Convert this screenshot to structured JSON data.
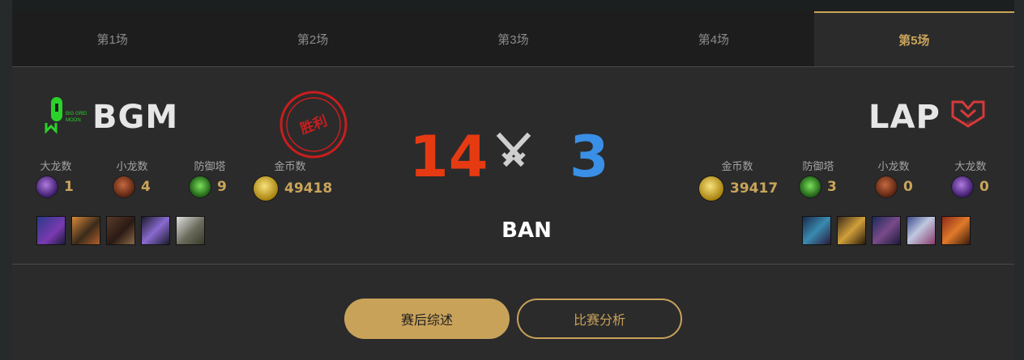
{
  "tabs": [
    {
      "label": "第1场"
    },
    {
      "label": "第2场"
    },
    {
      "label": "第3场"
    },
    {
      "label": "第4场"
    },
    {
      "label": "第5场",
      "active": true
    }
  ],
  "left_team": {
    "name": "BGM",
    "logo_icon": "bgm-logo-icon",
    "win_stamp": "胜利",
    "stats": [
      {
        "label": "大龙数",
        "value": "1",
        "icon": "baron-icon"
      },
      {
        "label": "小龙数",
        "value": "4",
        "icon": "dragon-icon"
      },
      {
        "label": "防御塔",
        "value": "9",
        "icon": "tower-icon"
      },
      {
        "label": "金币数",
        "value": "49418",
        "icon": "gold-icon"
      }
    ],
    "bans": [
      "champion-portrait-1",
      "champion-portrait-2",
      "champion-portrait-3",
      "champion-portrait-4",
      "champion-portrait-5"
    ]
  },
  "right_team": {
    "name": "LAP",
    "logo_icon": "lap-logo-icon",
    "stats": [
      {
        "label": "金币数",
        "value": "39417",
        "icon": "gold-icon"
      },
      {
        "label": "防御塔",
        "value": "3",
        "icon": "tower-icon"
      },
      {
        "label": "小龙数",
        "value": "0",
        "icon": "dragon-icon"
      },
      {
        "label": "大龙数",
        "value": "0",
        "icon": "baron-icon"
      }
    ],
    "bans": [
      "champion-portrait-6",
      "champion-portrait-7",
      "champion-portrait-8",
      "champion-portrait-9",
      "champion-portrait-10"
    ]
  },
  "score": {
    "left": "14",
    "right": "3",
    "versus_icon": "crossed-swords-icon"
  },
  "ban_label": "BAN",
  "buttons": {
    "summary": "赛后综述",
    "analysis": "比赛分析"
  },
  "colors": {
    "accent": "#c9a45b",
    "left_score": "#e63a12",
    "right_score": "#3a8fe6",
    "stamp": "#c81e1e"
  }
}
